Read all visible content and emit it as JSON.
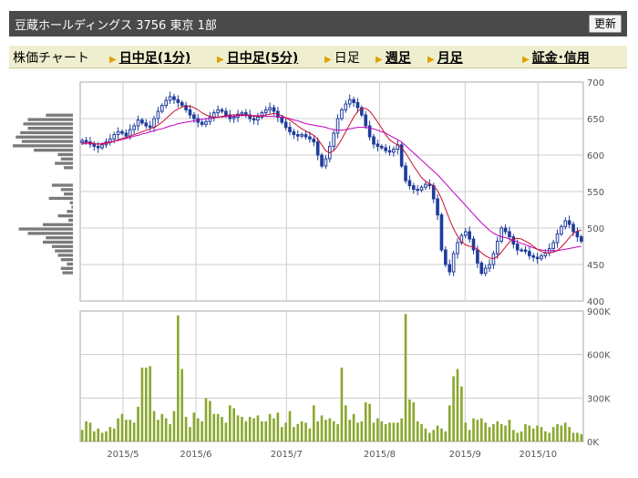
{
  "header": {
    "title": "豆蔵ホールディングス 3756 東京 1部",
    "reload_label": "更新"
  },
  "tabs": [
    {
      "label": "株価チャート",
      "link": false,
      "arrow": false
    },
    {
      "label": "日中足(1分)",
      "link": true,
      "arrow": true
    },
    {
      "label": "日中足(5分)",
      "link": true,
      "arrow": true
    },
    {
      "label": "日足",
      "link": false,
      "arrow": true
    },
    {
      "label": "週足",
      "link": true,
      "arrow": true
    },
    {
      "label": "月足",
      "link": true,
      "arrow": true
    },
    {
      "label": "証金･信用",
      "link": true,
      "arrow": true
    }
  ],
  "colors": {
    "candle": "#1f3c9b",
    "ma_short": "#c8102e",
    "ma_long": "#c000c0",
    "volume": "#8aa82e",
    "grid": "#cccccc",
    "profile": "#7a7a7a"
  },
  "chart_data": [
    {
      "type": "candlestick",
      "ylim": [
        400,
        700
      ],
      "yticks": [
        "700",
        "650",
        "600",
        "550",
        "500",
        "450",
        "400"
      ],
      "xticks": [
        "2015/5",
        "2015/6",
        "2015/7",
        "2015/8",
        "2015/9",
        "2015/10"
      ],
      "grid": true,
      "close": [
        620,
        618,
        615,
        612,
        610,
        614,
        618,
        622,
        628,
        632,
        630,
        626,
        635,
        640,
        648,
        644,
        640,
        638,
        650,
        660,
        668,
        675,
        680,
        676,
        672,
        668,
        662,
        655,
        650,
        645,
        642,
        646,
        652,
        658,
        662,
        660,
        655,
        650,
        652,
        656,
        658,
        655,
        650,
        648,
        652,
        658,
        662,
        665,
        660,
        652,
        645,
        638,
        632,
        628,
        626,
        628,
        625,
        622,
        618,
        600,
        585,
        595,
        612,
        630,
        650,
        662,
        670,
        676,
        672,
        665,
        655,
        640,
        625,
        615,
        612,
        610,
        606,
        604,
        608,
        614,
        585,
        565,
        558,
        553,
        552,
        556,
        560,
        558,
        540,
        518,
        470,
        450,
        440,
        465,
        480,
        490,
        495,
        485,
        470,
        452,
        438,
        445,
        450,
        465,
        482,
        500,
        495,
        488,
        478,
        470,
        470,
        468,
        462,
        460,
        458,
        462,
        466,
        472,
        480,
        492,
        502,
        510,
        505,
        495,
        488,
        482
      ],
      "ma_short": [
        615,
        616,
        617,
        616,
        615,
        615,
        616,
        617,
        619,
        621,
        623,
        624,
        626,
        628,
        630,
        632,
        634,
        636,
        638,
        641,
        645,
        650,
        655,
        660,
        663,
        666,
        667,
        667,
        665,
        662,
        658,
        655,
        653,
        652,
        652,
        653,
        654,
        655,
        655,
        655,
        655,
        655,
        654,
        653,
        653,
        654,
        655,
        656,
        657,
        656,
        654,
        651,
        648,
        644,
        640,
        636,
        633,
        630,
        627,
        622,
        614,
        606,
        603,
        606,
        613,
        622,
        632,
        642,
        652,
        660,
        664,
        664,
        660,
        653,
        645,
        637,
        628,
        621,
        617,
        614,
        610,
        603,
        594,
        585,
        577,
        569,
        564,
        561,
        558,
        551,
        540,
        526,
        512,
        499,
        489,
        481,
        477,
        475,
        474,
        471,
        466,
        462,
        459,
        458,
        461,
        467,
        474,
        481,
        485,
        486,
        485,
        482,
        479,
        475,
        471,
        468,
        466,
        466,
        467,
        469,
        474,
        480,
        487,
        493,
        496,
        497
      ],
      "ma_long": [
        618,
        617,
        616,
        615,
        615,
        616,
        617,
        618,
        619,
        620,
        621,
        623,
        624,
        626,
        627,
        629,
        630,
        632,
        633,
        635,
        636,
        638,
        640,
        641,
        643,
        644,
        645,
        646,
        647,
        648,
        649,
        650,
        650,
        651,
        652,
        652,
        653,
        653,
        653,
        654,
        654,
        654,
        654,
        654,
        654,
        653,
        653,
        653,
        653,
        652,
        652,
        651,
        650,
        648,
        647,
        645,
        643,
        642,
        641,
        640,
        639,
        638,
        636,
        635,
        634,
        634,
        635,
        636,
        637,
        638,
        638,
        638,
        637,
        636,
        634,
        632,
        630,
        627,
        624,
        621,
        618,
        613,
        608,
        603,
        598,
        593,
        588,
        583,
        578,
        573,
        567,
        561,
        555,
        549,
        543,
        537,
        531,
        525,
        519,
        513,
        507,
        502,
        497,
        493,
        490,
        488,
        487,
        485,
        483,
        481,
        479,
        477,
        475,
        473,
        471,
        470,
        469,
        469,
        469,
        469,
        470,
        471,
        472,
        473,
        474,
        475
      ],
      "price_profile": [
        0.0,
        0.0,
        0.0,
        0.0,
        0.0,
        0.0,
        0.0,
        0.18,
        0.3,
        0.33,
        0.3,
        0.35,
        0.38,
        0.34,
        0.4,
        0.26,
        0.1,
        0.08,
        0.12,
        0.06,
        0.0,
        0.0,
        0.0,
        0.14,
        0.08,
        0.06,
        0.16,
        0.02,
        0.01,
        0.04,
        0.1,
        0.03,
        0.2,
        0.36,
        0.3,
        0.18,
        0.2,
        0.14,
        0.12,
        0.1,
        0.08,
        0.04,
        0.08,
        0.07,
        0.0,
        0.0,
        0.0,
        0.0,
        0.0,
        0.0
      ]
    },
    {
      "type": "bar",
      "series": "volume",
      "ylim": [
        0,
        900000
      ],
      "yticks": [
        "900K",
        "600K",
        "300K",
        "0K"
      ],
      "values": [
        80000,
        140000,
        130000,
        70000,
        90000,
        60000,
        70000,
        100000,
        90000,
        160000,
        190000,
        150000,
        150000,
        130000,
        240000,
        510000,
        510000,
        520000,
        210000,
        150000,
        190000,
        160000,
        120000,
        210000,
        870000,
        500000,
        170000,
        100000,
        200000,
        160000,
        140000,
        300000,
        280000,
        190000,
        190000,
        170000,
        130000,
        250000,
        230000,
        180000,
        170000,
        140000,
        170000,
        160000,
        180000,
        140000,
        140000,
        190000,
        160000,
        200000,
        100000,
        130000,
        210000,
        100000,
        120000,
        140000,
        130000,
        90000,
        250000,
        140000,
        180000,
        150000,
        160000,
        140000,
        120000,
        510000,
        250000,
        150000,
        190000,
        130000,
        140000,
        270000,
        260000,
        130000,
        160000,
        140000,
        120000,
        130000,
        130000,
        130000,
        160000,
        880000,
        290000,
        270000,
        140000,
        120000,
        90000,
        60000,
        80000,
        110000,
        90000,
        70000,
        250000,
        450000,
        500000,
        380000,
        130000,
        80000,
        160000,
        150000,
        160000,
        130000,
        100000,
        120000,
        140000,
        120000,
        110000,
        150000,
        80000,
        60000,
        70000,
        120000,
        110000,
        90000,
        110000,
        100000,
        70000,
        60000,
        100000,
        120000,
        110000,
        130000,
        100000,
        60000,
        60000,
        50000
      ]
    }
  ]
}
